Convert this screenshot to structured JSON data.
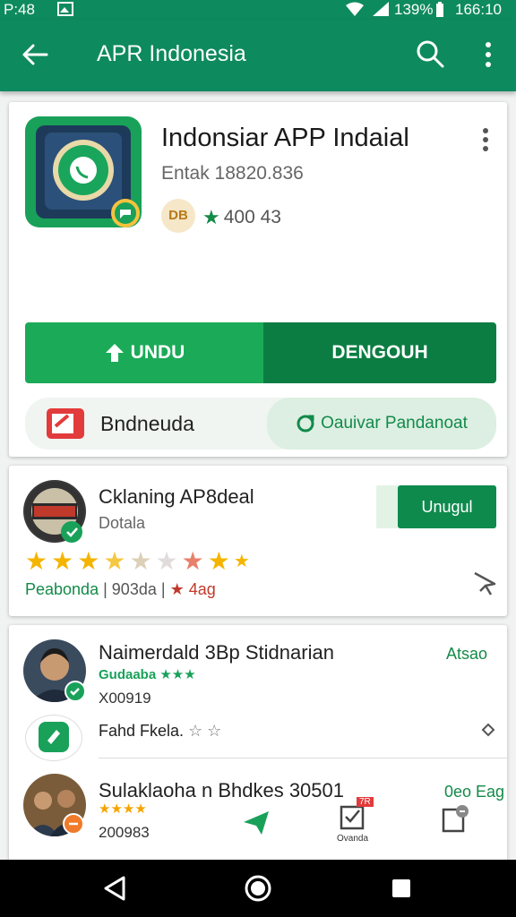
{
  "status_bar": {
    "time": "P:48",
    "battery": "139%",
    "clock": "166:10"
  },
  "app_bar": {
    "title": "APR Indonesia",
    "back_icon": "arrow-left-icon",
    "search_icon": "search-icon",
    "more_icon": "more-vert-icon"
  },
  "app_card": {
    "name": "Indonsiar APP Indaial",
    "developer": "Entak 18820.836",
    "badge": "DB",
    "rating": "400 43",
    "install_button": "UNDU",
    "secondary_button": "DENGOUH",
    "sub_label": "Bndneuda",
    "sub_action": "Oauivar Pandanoat"
  },
  "related_app": {
    "name": "Cklaning AP8deal",
    "subtitle": "Dotala",
    "button": "Unugul",
    "meta_tag": "Peabonda",
    "meta_count": "903da",
    "meta_rating": "4ag",
    "stars_rating": 4.5,
    "stars_total": 9
  },
  "list": {
    "items": [
      {
        "name": "Naimerdald 3Bp Stidnarian",
        "action": "Atsao",
        "rating_label": "Gudaaba",
        "number": "X00919"
      },
      {
        "name": "Fahd Fkela.",
        "action": ""
      },
      {
        "name": "Sulaklaoha n Bhdkes 30501",
        "action": "0eo Eag",
        "number": "200983"
      }
    ]
  },
  "dock": {
    "label": "Ovanda",
    "badge": "7R"
  },
  "colors": {
    "primary": "#0e8a5f",
    "accent": "#1bab58",
    "dark": "#0b7d42"
  }
}
